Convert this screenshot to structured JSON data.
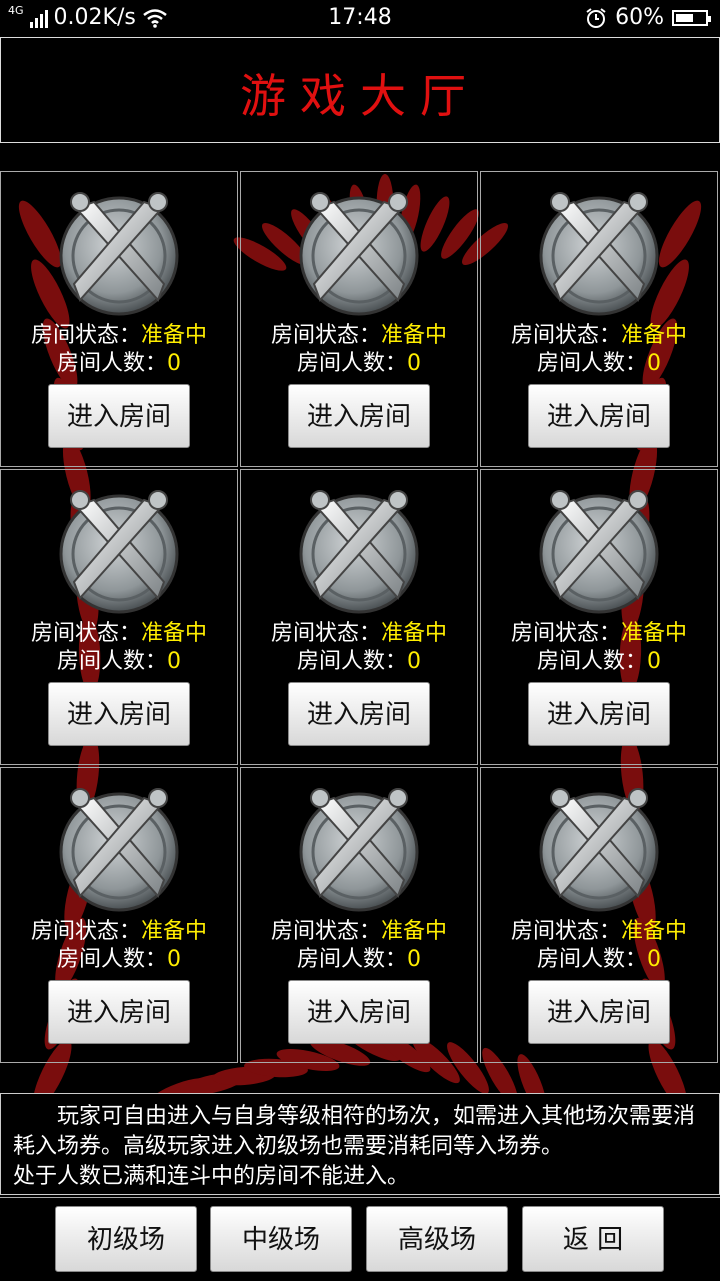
{
  "status_bar": {
    "network": "4G",
    "speed": "0.02K/s",
    "time": "17:48",
    "battery_percent": "60%",
    "battery_level": 0.6
  },
  "header": {
    "title": "游戏大厅"
  },
  "rooms": [
    {
      "status_label": "房间状态：",
      "status": "准备中",
      "count_label": "房间人数：",
      "count": "0",
      "enter_label": "进入房间"
    },
    {
      "status_label": "房间状态：",
      "status": "准备中",
      "count_label": "房间人数：",
      "count": "0",
      "enter_label": "进入房间"
    },
    {
      "status_label": "房间状态：",
      "status": "准备中",
      "count_label": "房间人数：",
      "count": "0",
      "enter_label": "进入房间"
    },
    {
      "status_label": "房间状态：",
      "status": "准备中",
      "count_label": "房间人数：",
      "count": "0",
      "enter_label": "进入房间"
    },
    {
      "status_label": "房间状态：",
      "status": "准备中",
      "count_label": "房间人数：",
      "count": "0",
      "enter_label": "进入房间"
    },
    {
      "status_label": "房间状态：",
      "status": "准备中",
      "count_label": "房间人数：",
      "count": "0",
      "enter_label": "进入房间"
    },
    {
      "status_label": "房间状态：",
      "status": "准备中",
      "count_label": "房间人数：",
      "count": "0",
      "enter_label": "进入房间"
    },
    {
      "status_label": "房间状态：",
      "status": "准备中",
      "count_label": "房间人数：",
      "count": "0",
      "enter_label": "进入房间"
    },
    {
      "status_label": "房间状态：",
      "status": "准备中",
      "count_label": "房间人数：",
      "count": "0",
      "enter_label": "进入房间"
    }
  ],
  "notice": {
    "line1": "　　玩家可自由进入与自身等级相符的场次，如需进入其他场次需要消耗入场券。高级玩家进入初级场也需要消耗同等入场券。",
    "line2": "处于人数已满和连斗中的房间不能进入。"
  },
  "nav": {
    "beginner": "初级场",
    "intermediate": "中级场",
    "advanced": "高级场",
    "back": "返 回"
  },
  "colors": {
    "title": "#e01010",
    "status_highlight": "#ffee00",
    "leaf": "#7a0d0d"
  }
}
